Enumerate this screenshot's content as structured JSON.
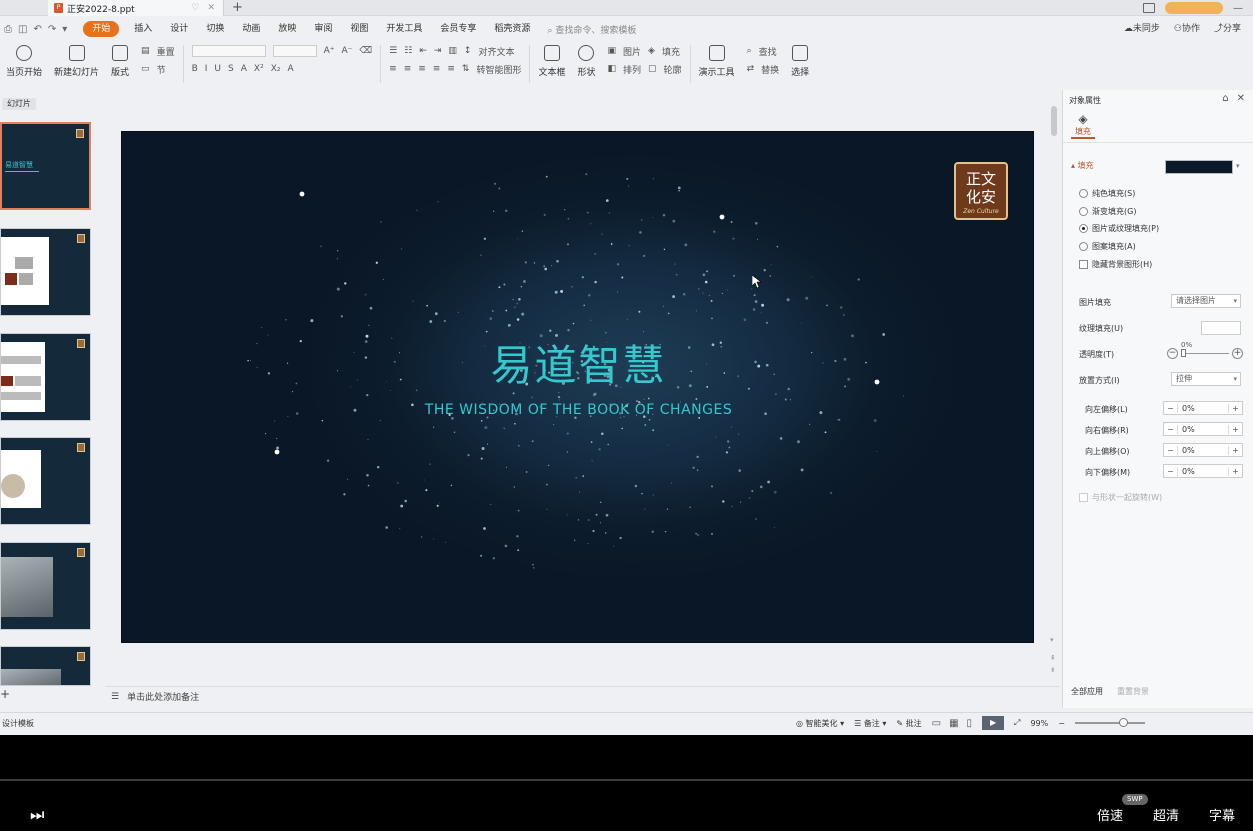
{
  "window": {
    "tab_title": "正安2022-8.ppt",
    "new_tab": "+",
    "file_icon": "ppt-file-icon"
  },
  "menubar": {
    "items": [
      {
        "label": "开始",
        "active": true
      },
      {
        "label": "插入"
      },
      {
        "label": "设计"
      },
      {
        "label": "切换"
      },
      {
        "label": "动画"
      },
      {
        "label": "放映"
      },
      {
        "label": "审阅"
      },
      {
        "label": "视图"
      },
      {
        "label": "开发工具"
      },
      {
        "label": "会员专享"
      },
      {
        "label": "稻壳资源"
      }
    ],
    "search_placeholder": "查找命令、搜索模板",
    "right": {
      "sync": "未同步",
      "collab": "协作",
      "share": "分享"
    }
  },
  "ribbon": {
    "play_from_current": "当页开始",
    "new_slide": "新建幻灯片",
    "layout": "版式",
    "section": "节",
    "reset": "重置",
    "textbox": "文本框",
    "shape": "形状",
    "arrange": "排列",
    "picture": "图片",
    "fill": "填充",
    "outline": "轮廓",
    "align_text": "对齐文本",
    "convert_smartart": "转智能图形",
    "presentation_tools": "演示工具",
    "find": "查找",
    "replace": "替换",
    "select": "选择"
  },
  "left_panel": {
    "label": "幻灯片",
    "thumb1_title": "易道智慧"
  },
  "slide": {
    "title": "易道智慧",
    "subtitle": "THE WISDOM OF THE BOOK OF CHANGES",
    "logo_text": "正文化安",
    "logo_sub": "Zen Culture"
  },
  "notes": {
    "placeholder": "单击此处添加备注"
  },
  "right_panel": {
    "header": "对象属性",
    "tab_fill": "填充",
    "fill_label": "填充",
    "fill_color": "#0b1a2a",
    "options": [
      {
        "label": "纯色填充(S)",
        "selected": false
      },
      {
        "label": "渐变填充(G)",
        "selected": false
      },
      {
        "label": "图片或纹理填充(P)",
        "selected": true
      },
      {
        "label": "图案填充(A)",
        "selected": false
      }
    ],
    "hide_bg": "隐藏背景图形(H)",
    "picture_fill_label": "图片填充",
    "picture_fill_value": "请选择图片",
    "texture_fill_label": "纹理填充(U)",
    "transparency_label": "透明度(T)",
    "transparency_value": "0%",
    "placement_label": "放置方式(I)",
    "placement_value": "拉伸",
    "offsets": [
      {
        "label": "向左偏移(L)",
        "value": "0%"
      },
      {
        "label": "向右偏移(R)",
        "value": "0%"
      },
      {
        "label": "向上偏移(O)",
        "value": "0%"
      },
      {
        "label": "向下偏移(M)",
        "value": "0%"
      }
    ],
    "rotate_with_shape": "与形状一起旋转(W)",
    "apply_all": "全部应用",
    "reset_bg": "重置背景"
  },
  "statusbar": {
    "design_template": "设计模板",
    "smart_beautify": "智能美化",
    "notes": "备注",
    "comment": "批注",
    "zoom": "99%"
  },
  "player": {
    "speed": "倍速",
    "quality": "超清",
    "subtitle": "字幕",
    "badge": "SWP"
  },
  "colors": {
    "accent": "#e8711a",
    "slide_text": "#35c8cf",
    "slide_bg": "#0c1c2c"
  }
}
